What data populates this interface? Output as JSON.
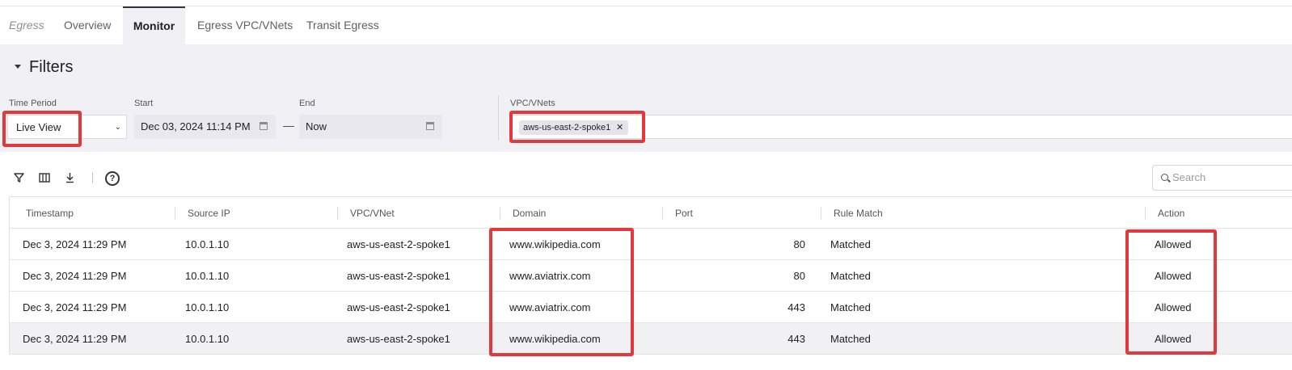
{
  "tabs": [
    {
      "label": "Egress"
    },
    {
      "label": "Overview"
    },
    {
      "label": "Monitor"
    },
    {
      "label": "Egress VPC/VNets"
    },
    {
      "label": "Transit Egress"
    }
  ],
  "filters": {
    "title": "Filters",
    "time_period": {
      "label": "Time Period",
      "value": "Live View"
    },
    "start": {
      "label": "Start",
      "value": "Dec 03, 2024 11:14 PM"
    },
    "separator": "—",
    "end": {
      "label": "End",
      "value": "Now"
    },
    "vpc": {
      "label": "VPC/VNets",
      "chip": "aws-us-east-2-spoke1",
      "chip_remove": "✕"
    }
  },
  "toolbar": {
    "help": "?",
    "search_placeholder": "Search"
  },
  "table": {
    "columns": [
      "Timestamp",
      "Source IP",
      "VPC/VNet",
      "Domain",
      "Port",
      "Rule Match",
      "Action"
    ],
    "rows": [
      {
        "timestamp": "Dec 3, 2024 11:29 PM",
        "source_ip": "10.0.1.10",
        "vpc": "aws-us-east-2-spoke1",
        "domain": "www.wikipedia.com",
        "port": "80",
        "rule": "Matched",
        "action": "Allowed"
      },
      {
        "timestamp": "Dec 3, 2024 11:29 PM",
        "source_ip": "10.0.1.10",
        "vpc": "aws-us-east-2-spoke1",
        "domain": "www.aviatrix.com",
        "port": "80",
        "rule": "Matched",
        "action": "Allowed"
      },
      {
        "timestamp": "Dec 3, 2024 11:29 PM",
        "source_ip": "10.0.1.10",
        "vpc": "aws-us-east-2-spoke1",
        "domain": "www.aviatrix.com",
        "port": "443",
        "rule": "Matched",
        "action": "Allowed"
      },
      {
        "timestamp": "Dec 3, 2024 11:29 PM",
        "source_ip": "10.0.1.10",
        "vpc": "aws-us-east-2-spoke1",
        "domain": "www.wikipedia.com",
        "port": "443",
        "rule": "Matched",
        "action": "Allowed"
      }
    ]
  },
  "colors": {
    "highlight": "#e0393e",
    "panel": "#f1f1f5"
  }
}
